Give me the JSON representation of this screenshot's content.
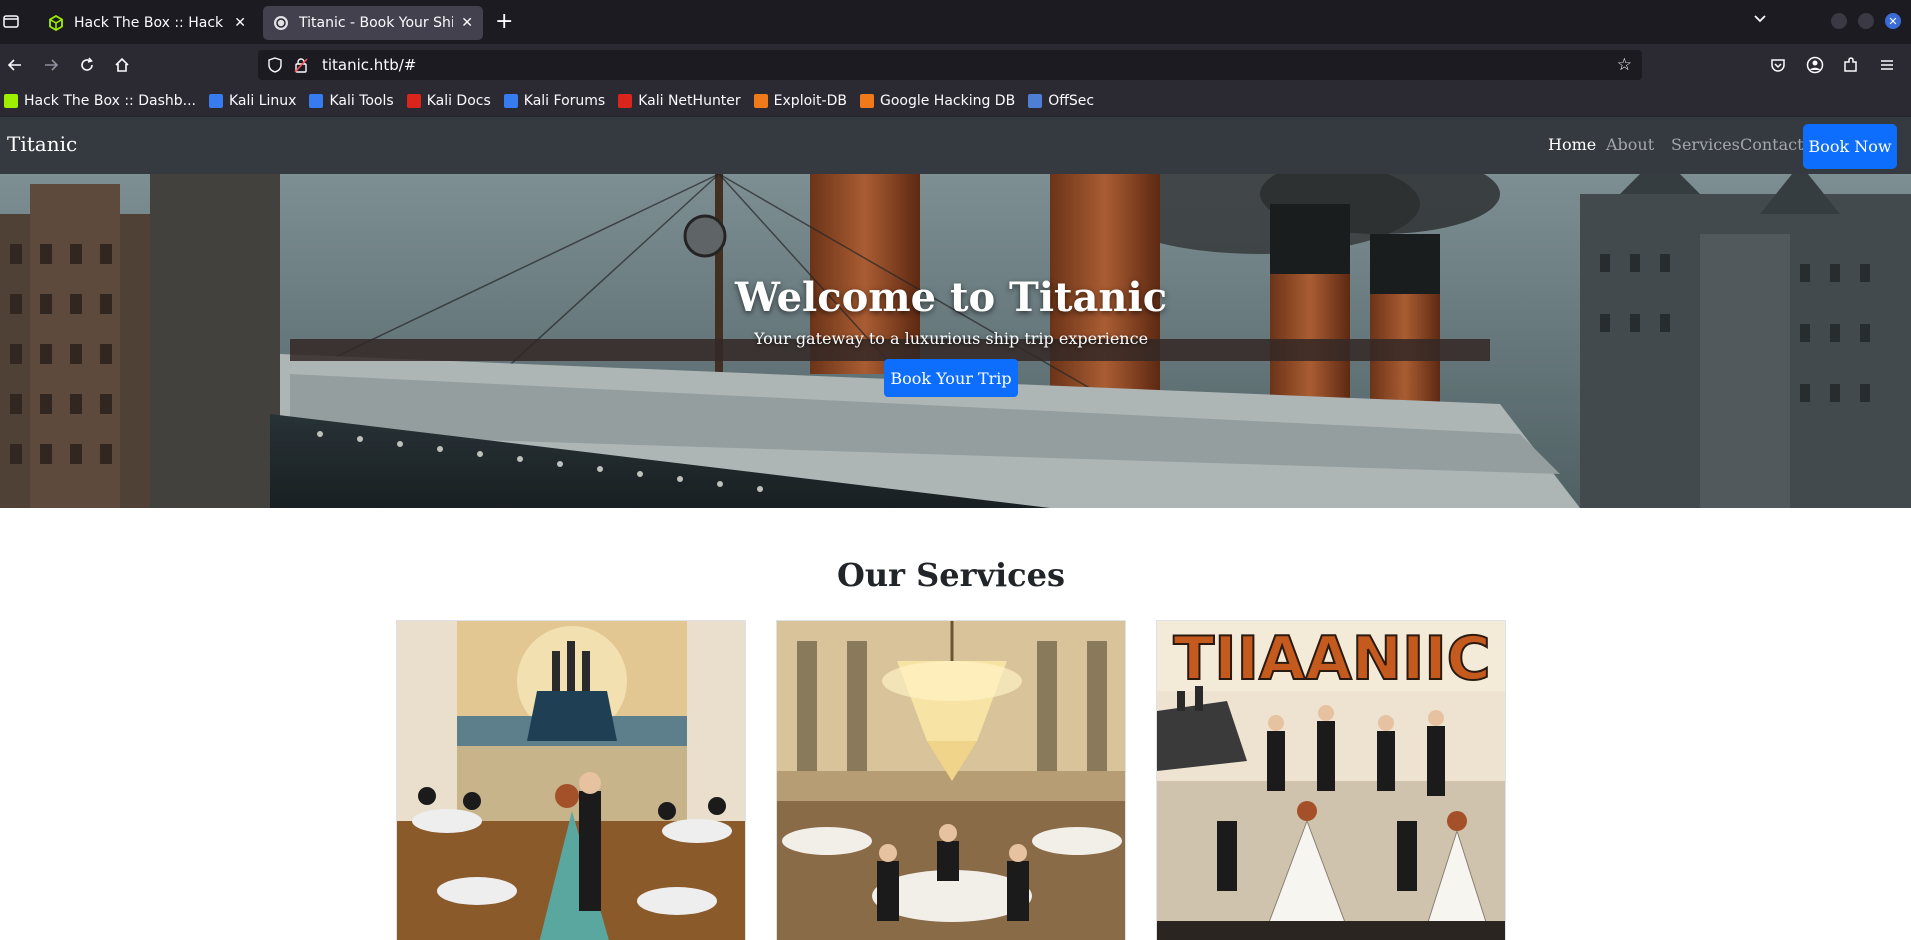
{
  "browser": {
    "tabs": [
      {
        "title": "Hack The Box :: Hack The Box",
        "active": false
      },
      {
        "title": "Titanic - Book Your Ship Trip",
        "active": true
      }
    ],
    "url": "titanic.htb/#",
    "bookmarks": [
      {
        "label": "Hack The Box :: Dashb...",
        "color": "#9fef00"
      },
      {
        "label": "Kali Linux",
        "color": "#367bf0"
      },
      {
        "label": "Kali Tools",
        "color": "#367bf0"
      },
      {
        "label": "Kali Docs",
        "color": "#d9251c"
      },
      {
        "label": "Kali Forums",
        "color": "#367bf0"
      },
      {
        "label": "Kali NetHunter",
        "color": "#d9251c"
      },
      {
        "label": "Exploit-DB",
        "color": "#f07a1a"
      },
      {
        "label": "Google Hacking DB",
        "color": "#f07a1a"
      },
      {
        "label": "OffSec",
        "color": "#4e7fd6"
      }
    ]
  },
  "site": {
    "brand": "Titanic",
    "menu": {
      "home": "Home",
      "about": "About",
      "services": "Services",
      "contact": "Contact",
      "book_now": "Book Now"
    },
    "hero": {
      "title": "Welcome to Titanic",
      "subtitle": "Your gateway to a luxurious ship trip experience",
      "button": "Book Your Trip"
    },
    "services": {
      "title": "Our Services"
    },
    "cards": [
      {
        "image": "ballroom-dancing-illustration"
      },
      {
        "image": "chandelier-dining-hall-illustration"
      },
      {
        "image": "titanic-show-poster",
        "poster_text": "TIIAANIIC"
      }
    ]
  },
  "colors": {
    "primary": "#0d6efd",
    "navbar": "#343a40",
    "browser_bg": "#1c1b22",
    "toolbar_bg": "#2b2a33"
  }
}
